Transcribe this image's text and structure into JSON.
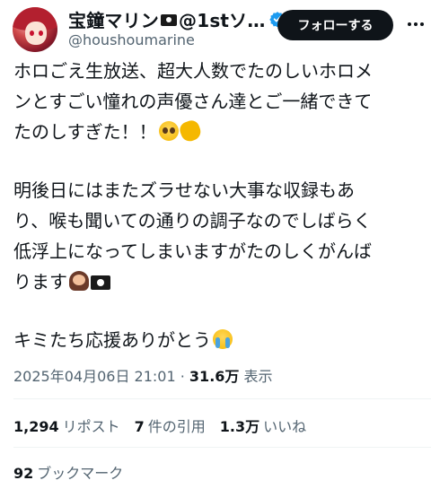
{
  "author": {
    "display_name": "宝鐘マリン",
    "display_name_suffix": "@1stソ…",
    "handle": "@houshoumarine"
  },
  "follow_button": {
    "label": "フォローする"
  },
  "tweet": {
    "lines": [
      "ホロごえ生放送、超大人数でたのしいホロメ",
      "ンとすごい憧れの声優さん達とご一緒できて",
      "たのしすぎた！！"
    ],
    "paragraph2": [
      "明後日にはまたズラせない大事な収録もあ",
      "り、喉も聞いての通りの調子なのでしばらく",
      "低浮上になってしまいますがたのしくがんば",
      "ります"
    ],
    "paragraph3": "キミたち応援ありがとう"
  },
  "meta": {
    "datetime": "2025年04月06日 21:01",
    "separator": "·",
    "views_count": "31.6万",
    "views_label": "表示"
  },
  "stats": {
    "reposts": {
      "count": "1,294",
      "label": "リポスト"
    },
    "quotes": {
      "count": "7",
      "label": "件の引用"
    },
    "likes": {
      "count": "1.3万",
      "label": "いいね"
    },
    "bookmarks": {
      "count": "92",
      "label": "ブックマーク"
    }
  },
  "colors": {
    "text_primary": "#0f1419",
    "text_secondary": "#536471",
    "verified_blue": "#1d9bf0",
    "button_bg": "#0f1419",
    "divider": "#eff3f4"
  },
  "icons": [
    "avatar",
    "pirate-flag-icon",
    "verified-icon",
    "more-icon",
    "pleading-face-icon",
    "clapping-hands-icon",
    "person-bowing-icon",
    "crying-face-icon"
  ]
}
